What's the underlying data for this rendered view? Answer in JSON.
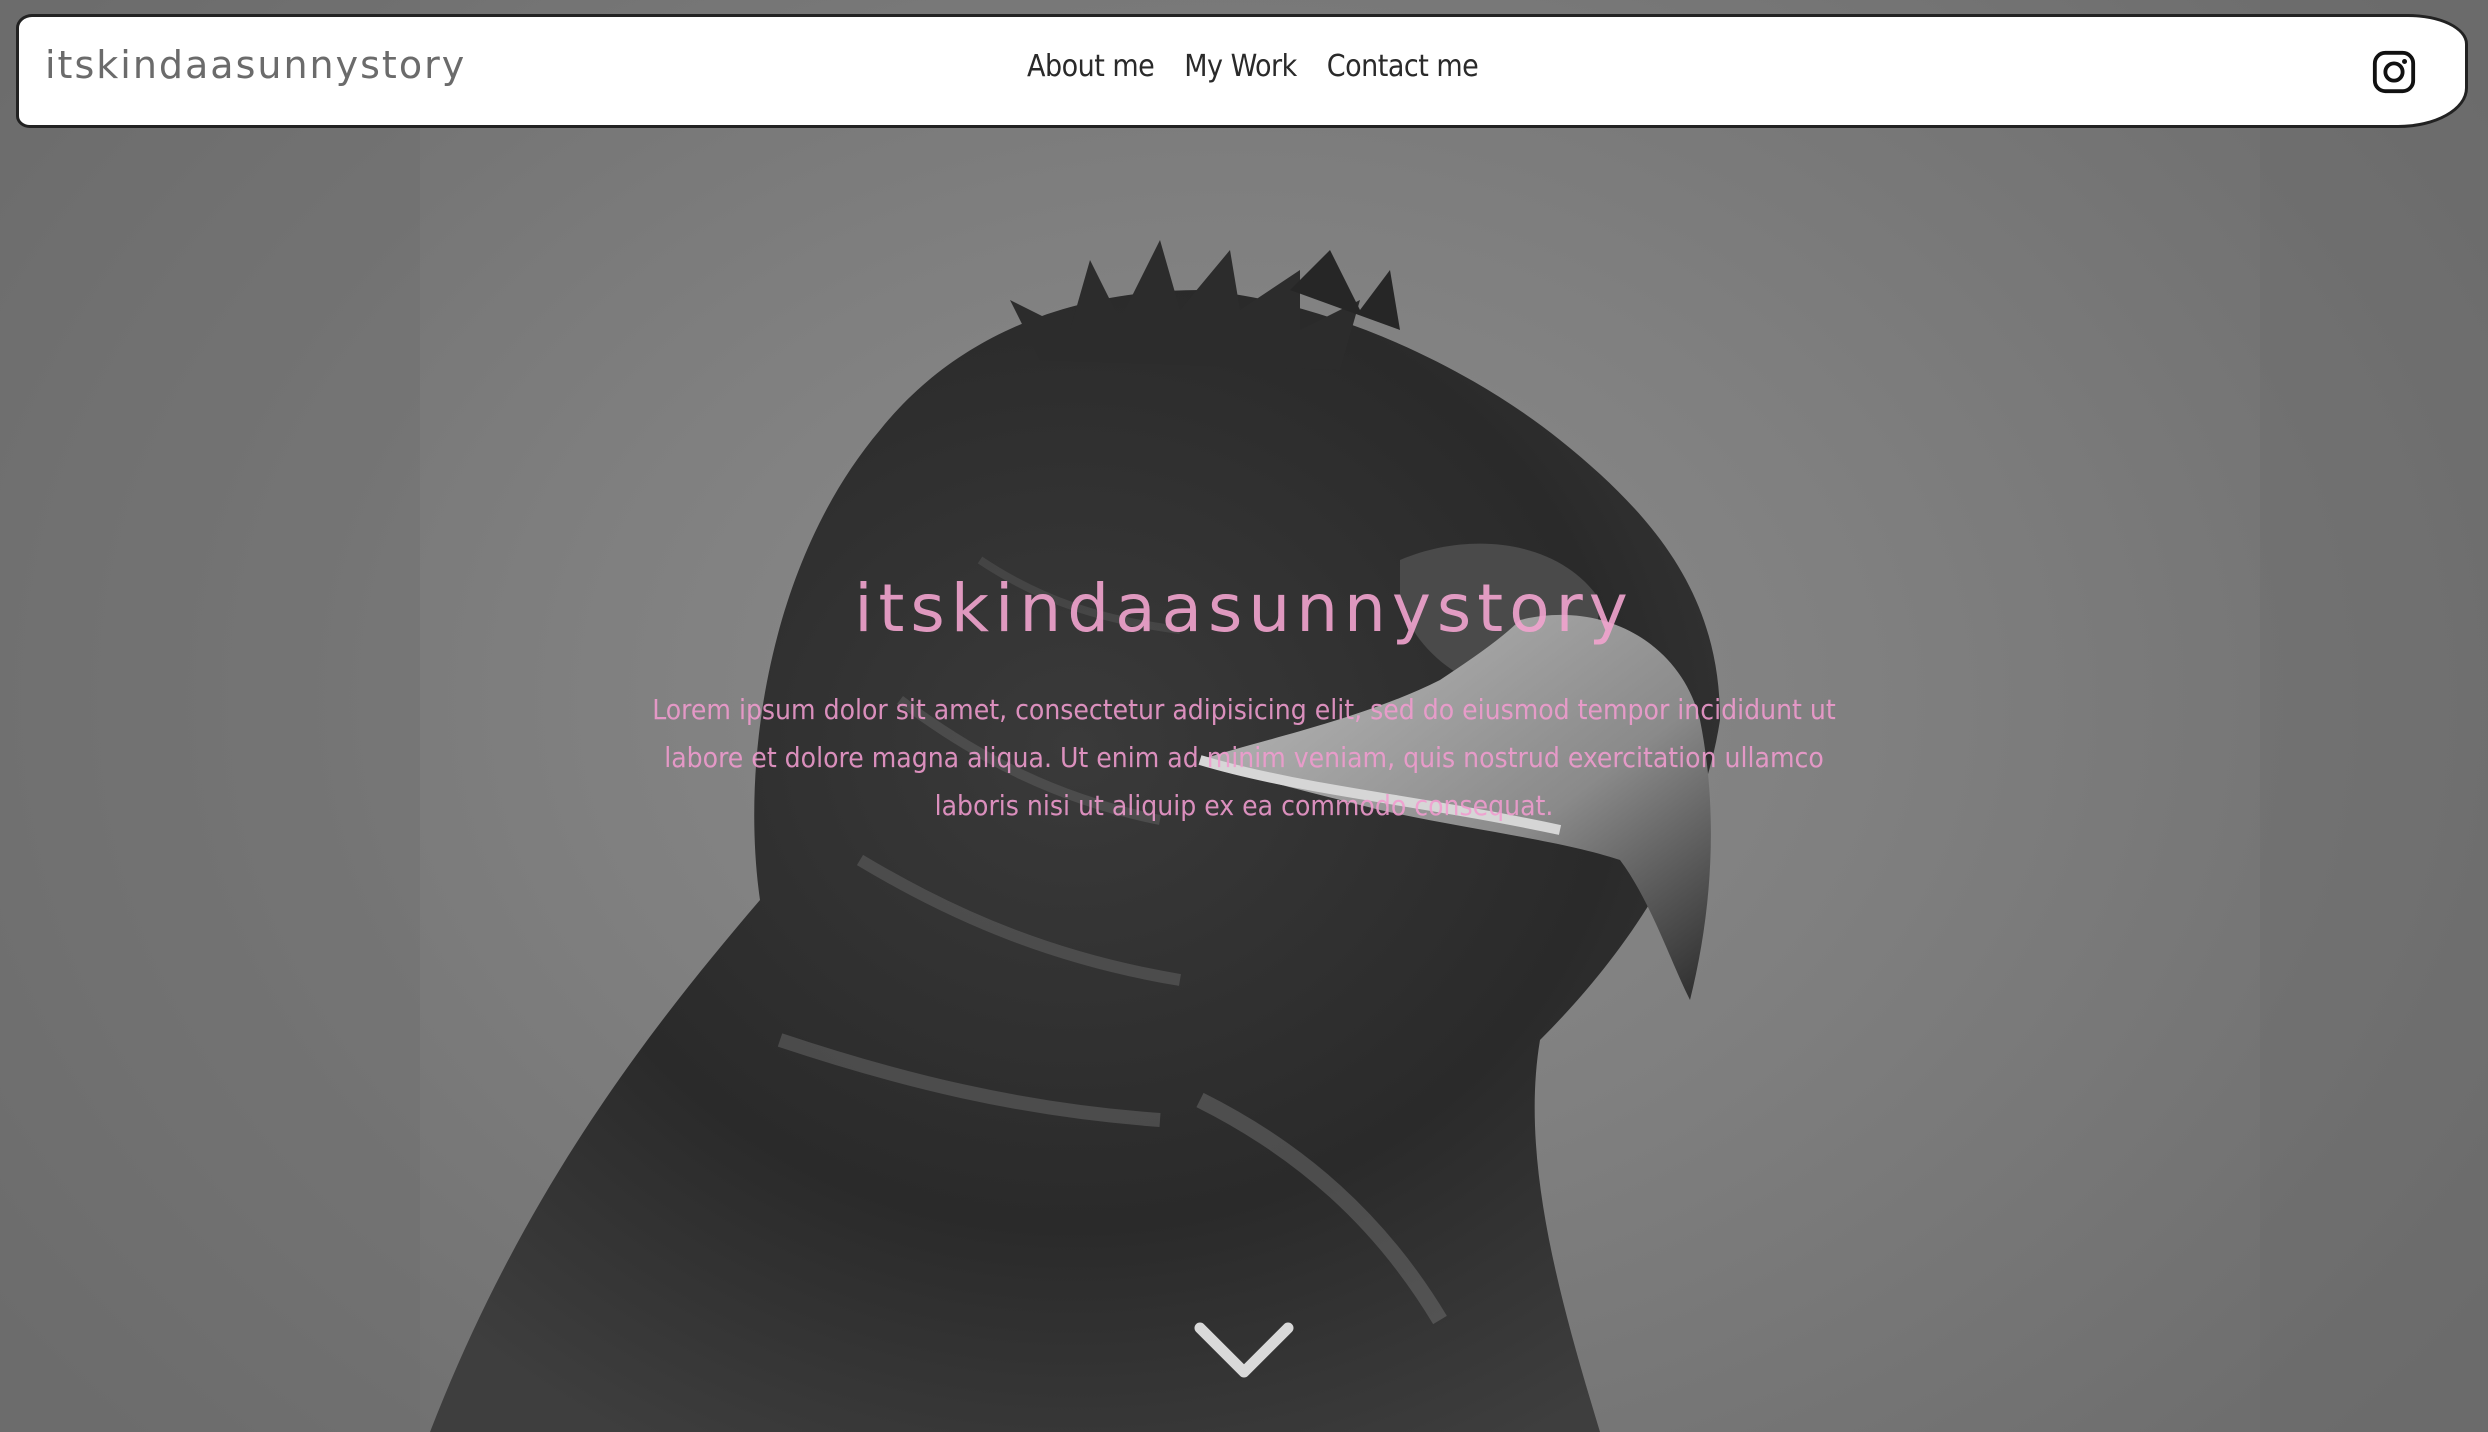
{
  "brand": {
    "name": "itskindaasunnystory"
  },
  "nav": {
    "items": [
      {
        "label": "About me"
      },
      {
        "label": "My Work"
      },
      {
        "label": "Contact me"
      }
    ]
  },
  "social": {
    "icon": "instagram-icon"
  },
  "hero": {
    "title": "itskindaasunnystory",
    "text": "Lorem ipsum dolor sit amet, consectetur adipisicing elit, sed do eiusmod tempor incididunt ut labore et dolore magna aliqua. Ut enim ad minim veniam, quis nostrud exercitation ullamco laboris nisi ut aliquip ex ea commodo consequat.",
    "scroll_icon": "chevron-down-icon"
  },
  "colors": {
    "accent_pink": "#f29cd0",
    "nav_background": "#ffffff",
    "nav_border": "#222222",
    "brand_text": "#6b6b6b"
  }
}
